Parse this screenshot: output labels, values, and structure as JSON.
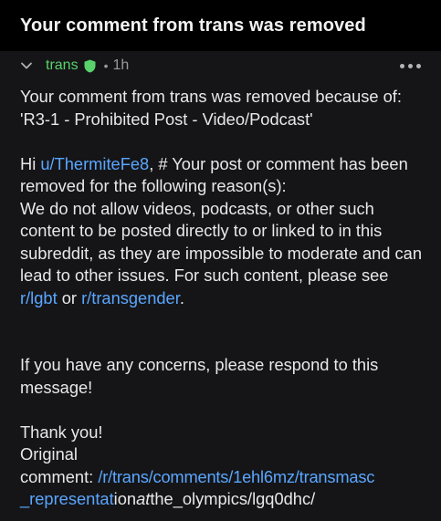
{
  "header": {
    "title": "Your comment from trans was removed"
  },
  "meta": {
    "author": "trans",
    "separator": "•",
    "time": "1h"
  },
  "body": {
    "intro": "Your comment from trans was removed because of: 'R3-1 - Prohibited Post - Video/Podcast'",
    "greeting": "Hi ",
    "user_link": "u/ThermiteFe8",
    "reason_head": ", # Your post or comment has been removed for the following reason(s):",
    "reason_text": "We do not allow videos, podcasts, or other such content to be posted directly to or linked to in this subreddit, as they are impossible to moderate and can lead to other issues.  For such content, please see ",
    "link_lgbt": "r/lgbt",
    "or_text": " or ",
    "link_transgender": "r/transgender",
    "period": ".",
    "concerns": "If you have any concerns, please respond to this message!",
    "thanks": "Thank you!",
    "original_label_1": "Original",
    "original_label_2": "comment: ",
    "original_link_a": "/r/trans/comments/1ehl6mz/transmasc",
    "original_link_b": "_representat",
    "original_plain_c": "ion",
    "original_plain_d": "at",
    "original_plain_e": "the_olympics/lgq0dhc/"
  },
  "colors": {
    "accent_link": "#5aa6ff",
    "author_green": "#59d26b"
  },
  "icons": {
    "collapse": "chevron-down-icon",
    "mod": "shield-icon",
    "menu": "more-options-icon"
  }
}
